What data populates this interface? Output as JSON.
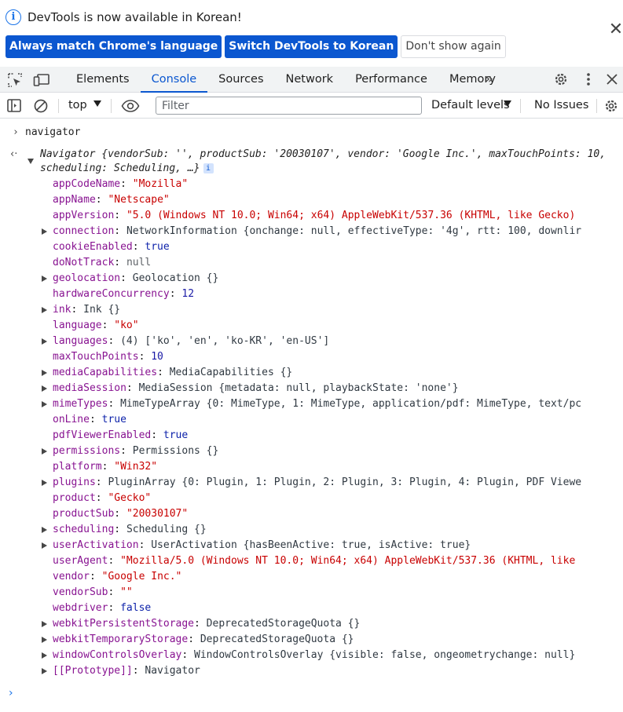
{
  "banner": {
    "message": "DevTools is now available in Korean!",
    "btn_match": "Always match Chrome's language",
    "btn_switch": "Switch DevTools to Korean",
    "btn_dont_show": "Don't show again",
    "close_glyph": "✕",
    "info_glyph": "i"
  },
  "tabs": {
    "items": [
      "Elements",
      "Console",
      "Sources",
      "Network",
      "Performance",
      "Memory"
    ],
    "active": "Console",
    "more_glyph": "»"
  },
  "console_toolbar": {
    "context": "top",
    "filter_placeholder": "Filter",
    "levels": "Default levels",
    "issues": "No Issues"
  },
  "console": {
    "command": "navigator",
    "result_summary": "Navigator {vendorSub: '', productSub: '20030107', vendor: 'Google Inc.', maxTouchPoints: 10, scheduling: Scheduling, …}",
    "properties": [
      {
        "key": "appCodeName",
        "value": "\"Mozilla\"",
        "kind": "str",
        "expandable": false
      },
      {
        "key": "appName",
        "value": "\"Netscape\"",
        "kind": "str",
        "expandable": false
      },
      {
        "key": "appVersion",
        "value": "\"5.0 (Windows NT 10.0; Win64; x64) AppleWebKit/537.36 (KHTML, like Gecko)",
        "kind": "str",
        "expandable": false
      },
      {
        "key": "connection",
        "value": "NetworkInformation {onchange: null, effectiveType: '4g', rtt: 100, downlir",
        "kind": "obj",
        "expandable": true
      },
      {
        "key": "cookieEnabled",
        "value": "true",
        "kind": "bool",
        "expandable": false
      },
      {
        "key": "doNotTrack",
        "value": "null",
        "kind": "null",
        "expandable": false
      },
      {
        "key": "geolocation",
        "value": "Geolocation {}",
        "kind": "obj",
        "expandable": true
      },
      {
        "key": "hardwareConcurrency",
        "value": "12",
        "kind": "num",
        "expandable": false
      },
      {
        "key": "ink",
        "value": "Ink {}",
        "kind": "obj",
        "expandable": true
      },
      {
        "key": "language",
        "value": "\"ko\"",
        "kind": "str",
        "expandable": false
      },
      {
        "key": "languages",
        "value": "(4) ['ko', 'en', 'ko-KR', 'en-US']",
        "kind": "obj",
        "expandable": true
      },
      {
        "key": "maxTouchPoints",
        "value": "10",
        "kind": "num",
        "expandable": false
      },
      {
        "key": "mediaCapabilities",
        "value": "MediaCapabilities {}",
        "kind": "obj",
        "expandable": true
      },
      {
        "key": "mediaSession",
        "value": "MediaSession {metadata: null, playbackState: 'none'}",
        "kind": "obj",
        "expandable": true
      },
      {
        "key": "mimeTypes",
        "value": "MimeTypeArray {0: MimeType, 1: MimeType, application/pdf: MimeType, text/pc",
        "kind": "obj",
        "expandable": true
      },
      {
        "key": "onLine",
        "value": "true",
        "kind": "bool",
        "expandable": false
      },
      {
        "key": "pdfViewerEnabled",
        "value": "true",
        "kind": "bool",
        "expandable": false
      },
      {
        "key": "permissions",
        "value": "Permissions {}",
        "kind": "obj",
        "expandable": true
      },
      {
        "key": "platform",
        "value": "\"Win32\"",
        "kind": "str",
        "expandable": false
      },
      {
        "key": "plugins",
        "value": "PluginArray {0: Plugin, 1: Plugin, 2: Plugin, 3: Plugin, 4: Plugin, PDF Viewe",
        "kind": "obj",
        "expandable": true
      },
      {
        "key": "product",
        "value": "\"Gecko\"",
        "kind": "str",
        "expandable": false
      },
      {
        "key": "productSub",
        "value": "\"20030107\"",
        "kind": "str",
        "expandable": false
      },
      {
        "key": "scheduling",
        "value": "Scheduling {}",
        "kind": "obj",
        "expandable": true
      },
      {
        "key": "userActivation",
        "value": "UserActivation {hasBeenActive: true, isActive: true}",
        "kind": "obj",
        "expandable": true
      },
      {
        "key": "userAgent",
        "value": "\"Mozilla/5.0 (Windows NT 10.0; Win64; x64) AppleWebKit/537.36 (KHTML, like",
        "kind": "str",
        "expandable": false
      },
      {
        "key": "vendor",
        "value": "\"Google Inc.\"",
        "kind": "str",
        "expandable": false
      },
      {
        "key": "vendorSub",
        "value": "\"\"",
        "kind": "str",
        "expandable": false
      },
      {
        "key": "webdriver",
        "value": "false",
        "kind": "bool",
        "expandable": false
      },
      {
        "key": "webkitPersistentStorage",
        "value": "DeprecatedStorageQuota {}",
        "kind": "obj",
        "expandable": true
      },
      {
        "key": "webkitTemporaryStorage",
        "value": "DeprecatedStorageQuota {}",
        "kind": "obj",
        "expandable": true
      },
      {
        "key": "windowControlsOverlay",
        "value": "WindowControlsOverlay {visible: false, ongeometrychange: null}",
        "kind": "obj",
        "expandable": true
      },
      {
        "key": "[[Prototype]]",
        "value": "Navigator",
        "kind": "obj",
        "expandable": true
      }
    ]
  },
  "icons": {
    "inspect": "inspect-element-icon",
    "device": "device-toolbar-icon",
    "settings": "settings-gear-icon",
    "menu": "kebab-menu-icon",
    "close": "close-icon",
    "sidebar": "console-sidebar-icon",
    "clear": "clear-console-icon",
    "eye": "live-expression-eye-icon"
  },
  "colors": {
    "accent": "#0b57d0",
    "string": "#c80000",
    "number": "#1a1aa6",
    "key": "#881391"
  }
}
